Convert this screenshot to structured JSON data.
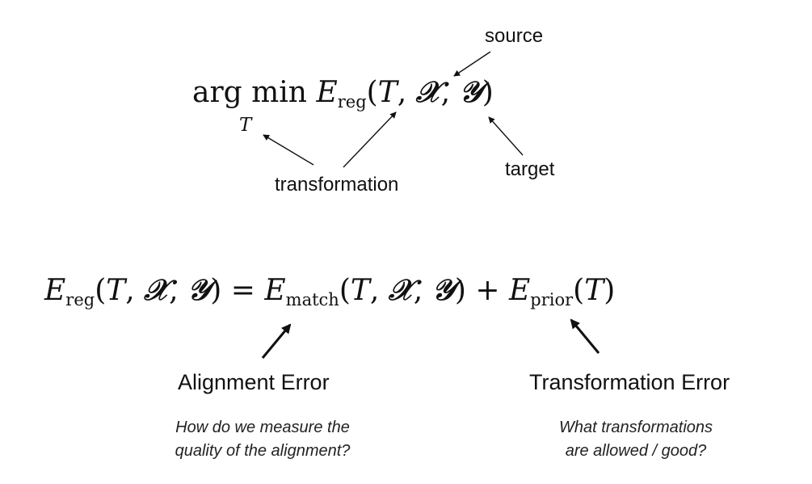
{
  "equation_top": {
    "op": "arg min",
    "op_sub": "T",
    "E": "E",
    "E_sub": "reg",
    "args": [
      "T",
      "𝒳",
      "𝒴"
    ]
  },
  "annotations_top": {
    "source": "source",
    "transformation": "transformation",
    "target": "target"
  },
  "equation_bottom": {
    "lhs_E": "E",
    "lhs_sub": "reg",
    "args": [
      "T",
      "𝒳",
      "𝒴"
    ],
    "equals": "=",
    "match_E": "E",
    "match_sub": "match",
    "plus": "+",
    "prior_E": "E",
    "prior_sub": "prior",
    "prior_arg": "T"
  },
  "alignment": {
    "title": "Alignment Error",
    "question_line1": "How do we measure the",
    "question_line2": "quality of the alignment?"
  },
  "transformation_error": {
    "title": "Transformation Error",
    "question_line1": "What transformations",
    "question_line2": "are allowed / good?"
  }
}
